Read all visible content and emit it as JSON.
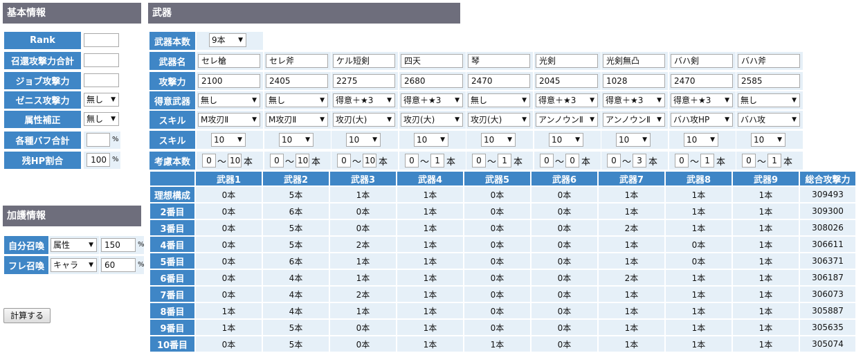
{
  "basic": {
    "title": "基本情報",
    "rows": [
      {
        "label": "Rank",
        "value": ""
      },
      {
        "label": "召還攻撃力合計",
        "value": ""
      },
      {
        "label": "ジョブ攻撃力",
        "value": ""
      },
      {
        "label": "ゼニス攻撃力",
        "select": "無し"
      },
      {
        "label": "属性補正",
        "select": "無し"
      },
      {
        "label": "各種バフ合計",
        "value": "",
        "unit": "%"
      },
      {
        "label": "残HP割合",
        "value": "100",
        "unit": "%"
      }
    ]
  },
  "divine": {
    "title": "加護情報",
    "rows": [
      {
        "label": "自分召喚",
        "select": "属性",
        "value": "150",
        "unit": "%"
      },
      {
        "label": "フレ召喚",
        "select": "キャラ",
        "value": "60",
        "unit": "%"
      }
    ]
  },
  "calc_button": "計算する",
  "weapons": {
    "title": "武器",
    "count_label": "武器本数",
    "count_value": "9本",
    "name_label": "武器名",
    "atk_label": "攻撃力",
    "fav_label": "得意武器",
    "skill_label": "スキル",
    "skill2_label": "スキル",
    "range_label": "考慮本数",
    "tilde": "〜",
    "unit": "本",
    "items": [
      {
        "name": "セレ槍",
        "atk": "2100",
        "fav": "無し",
        "skill": "M攻刃Ⅱ",
        "lv": "10",
        "min": "0",
        "max": "10"
      },
      {
        "name": "セレ斧",
        "atk": "2405",
        "fav": "無し",
        "skill": "M攻刃Ⅱ",
        "lv": "10",
        "min": "0",
        "max": "10"
      },
      {
        "name": "ケル短剣",
        "atk": "2275",
        "fav": "得意＋★3",
        "skill": "攻刃(大)",
        "lv": "10",
        "min": "0",
        "max": "10"
      },
      {
        "name": "四天",
        "atk": "2680",
        "fav": "得意＋★3",
        "skill": "攻刃(大)",
        "lv": "10",
        "min": "0",
        "max": "1"
      },
      {
        "name": "琴",
        "atk": "2470",
        "fav": "無し",
        "skill": "攻刃(大)",
        "lv": "10",
        "min": "0",
        "max": "1"
      },
      {
        "name": "光剣",
        "atk": "2045",
        "fav": "得意＋★3",
        "skill": "アンノウンⅡ",
        "lv": "10",
        "min": "0",
        "max": "0"
      },
      {
        "name": "光剣無凸",
        "atk": "1028",
        "fav": "得意＋★3",
        "skill": "アンノウンⅡ",
        "lv": "10",
        "min": "0",
        "max": "3"
      },
      {
        "name": "バハ剣",
        "atk": "2470",
        "fav": "得意＋★3",
        "skill": "バハ攻HP",
        "lv": "10",
        "min": "0",
        "max": "1"
      },
      {
        "name": "バハ斧",
        "atk": "2585",
        "fav": "無し",
        "skill": "バハ攻",
        "lv": "10",
        "min": "0",
        "max": "1"
      }
    ]
  },
  "results": {
    "headers": [
      "武器1",
      "武器2",
      "武器3",
      "武器4",
      "武器5",
      "武器6",
      "武器7",
      "武器8",
      "武器9",
      "総合攻撃力"
    ],
    "rows": [
      {
        "label": "理想構成",
        "cells": [
          "0本",
          "5本",
          "1本",
          "1本",
          "0本",
          "0本",
          "1本",
          "1本",
          "1本",
          "309493"
        ]
      },
      {
        "label": "2番目",
        "cells": [
          "0本",
          "6本",
          "0本",
          "1本",
          "0本",
          "0本",
          "1本",
          "1本",
          "1本",
          "309300"
        ]
      },
      {
        "label": "3番目",
        "cells": [
          "0本",
          "5本",
          "0本",
          "1本",
          "0本",
          "0本",
          "2本",
          "1本",
          "1本",
          "308026"
        ]
      },
      {
        "label": "4番目",
        "cells": [
          "0本",
          "5本",
          "2本",
          "1本",
          "0本",
          "0本",
          "1本",
          "0本",
          "1本",
          "306611"
        ]
      },
      {
        "label": "5番目",
        "cells": [
          "0本",
          "6本",
          "1本",
          "1本",
          "0本",
          "0本",
          "1本",
          "0本",
          "1本",
          "306371"
        ]
      },
      {
        "label": "6番目",
        "cells": [
          "0本",
          "4本",
          "1本",
          "1本",
          "0本",
          "0本",
          "2本",
          "1本",
          "1本",
          "306187"
        ]
      },
      {
        "label": "7番目",
        "cells": [
          "0本",
          "4本",
          "2本",
          "1本",
          "0本",
          "0本",
          "1本",
          "1本",
          "1本",
          "306073"
        ]
      },
      {
        "label": "8番目",
        "cells": [
          "1本",
          "4本",
          "1本",
          "1本",
          "0本",
          "0本",
          "1本",
          "1本",
          "1本",
          "305887"
        ]
      },
      {
        "label": "9番目",
        "cells": [
          "1本",
          "5本",
          "0本",
          "1本",
          "0本",
          "0本",
          "1本",
          "1本",
          "1本",
          "305635"
        ]
      },
      {
        "label": "10番目",
        "cells": [
          "0本",
          "5本",
          "0本",
          "1本",
          "1本",
          "0本",
          "1本",
          "1本",
          "1本",
          "305074"
        ]
      }
    ]
  }
}
